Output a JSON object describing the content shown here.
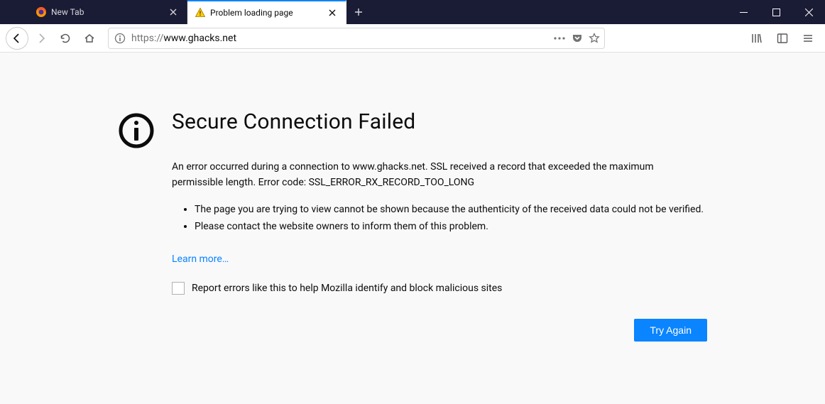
{
  "tabs": {
    "tab1": {
      "label": "New Tab"
    },
    "tab2": {
      "label": "Problem loading page"
    }
  },
  "url": {
    "protocol": "https://",
    "host": "www.ghacks.net"
  },
  "error": {
    "title": "Secure Connection Failed",
    "description": "An error occurred during a connection to www.ghacks.net. SSL received a record that exceeded the maximum permissible length. Error code: SSL_ERROR_RX_RECORD_TOO_LONG",
    "bullet1": "The page you are trying to view cannot be shown because the authenticity of the received data could not be verified.",
    "bullet2": "Please contact the website owners to inform them of this problem.",
    "learn_more": "Learn more…",
    "report_label": "Report errors like this to help Mozilla identify and block malicious sites",
    "try_again": "Try Again"
  }
}
